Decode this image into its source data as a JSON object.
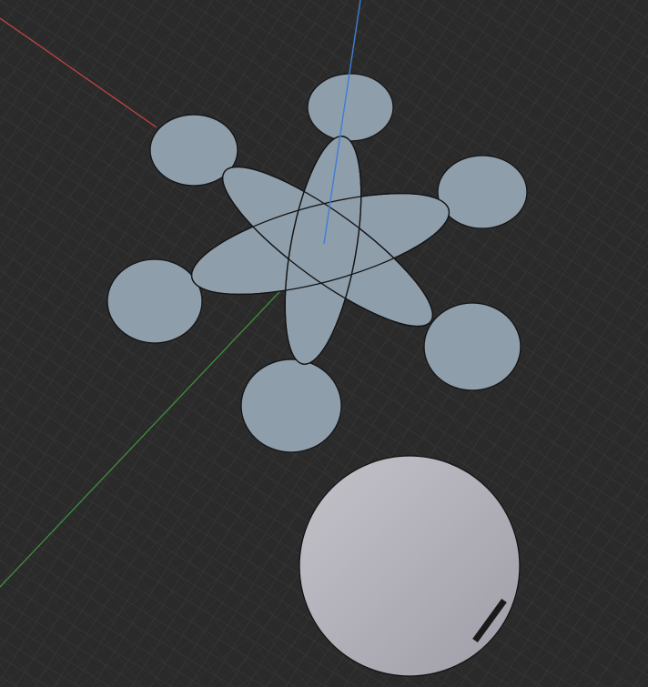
{
  "viewport": {
    "background": "#2a2a2a",
    "grid_visible": true,
    "grid_color": "#3a3a3a",
    "axes": {
      "x_color": "#c0443e",
      "y_color": "#3f8f3a",
      "z_color": "#3d7fd6"
    }
  },
  "objects": [
    {
      "name": "drone-frame",
      "type": "mesh",
      "color": "#8e9eab"
    },
    {
      "name": "disc",
      "type": "mesh",
      "color": "#a9a7b0"
    }
  ]
}
